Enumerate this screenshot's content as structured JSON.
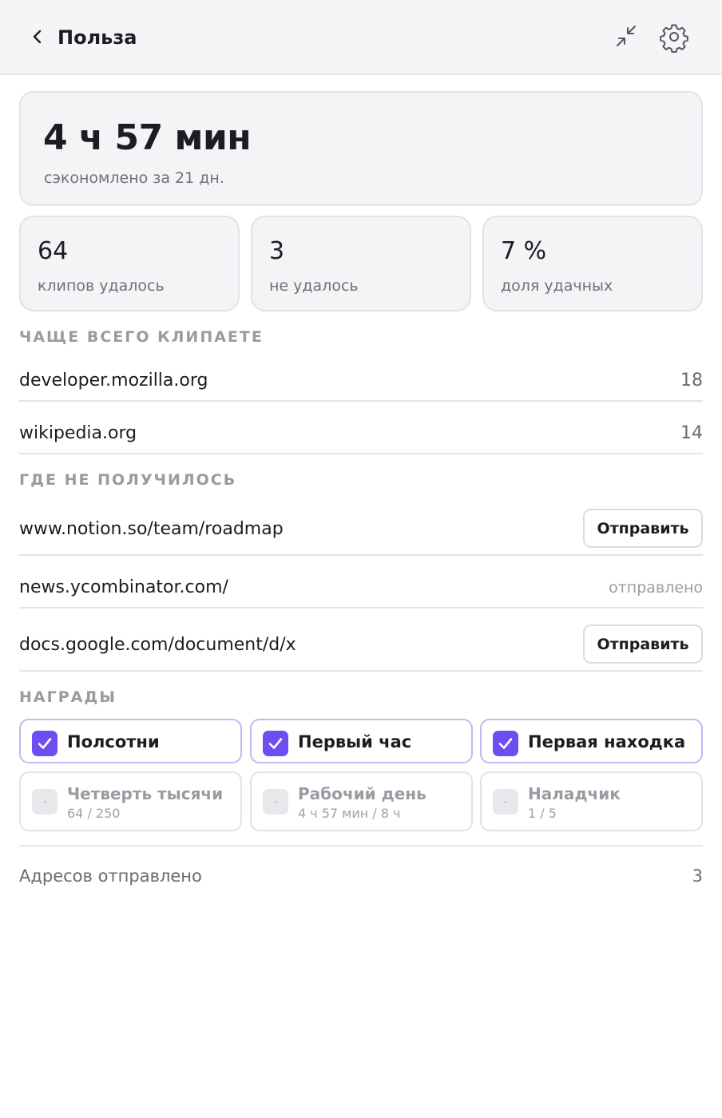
{
  "header": {
    "title": "Польза"
  },
  "summary": {
    "saved_time": "4 ч 57 мин",
    "saved_caption": "сэкономлено за 21 дн."
  },
  "stats": [
    {
      "value": "64",
      "label": "клипов удалось"
    },
    {
      "value": "3",
      "label": "не удалось"
    },
    {
      "value": "7 %",
      "label": "доля удачных"
    }
  ],
  "top_sites": {
    "heading": "ЧАЩЕ ВСЕГО КЛИПАЕТЕ",
    "items": [
      {
        "site": "developer.mozilla.org",
        "count": "18"
      },
      {
        "site": "wikipedia.org",
        "count": "14"
      }
    ]
  },
  "failures": {
    "heading": "ГДЕ НЕ ПОЛУЧИЛОСЬ",
    "items": [
      {
        "site": "www.notion.so/team/roadmap",
        "action": "Отправить"
      },
      {
        "site": "news.ycombinator.com/",
        "status": "отправлено"
      },
      {
        "site": "docs.google.com/document/d/x",
        "action": "Отправить"
      }
    ]
  },
  "awards": {
    "heading": "НАГРАДЫ",
    "items": [
      {
        "name": "Полсотни",
        "earned": true
      },
      {
        "name": "Первый час",
        "earned": true
      },
      {
        "name": "Первая находка",
        "earned": true
      },
      {
        "name": "Четверть тысячи",
        "earned": false,
        "progress": "64 / 250"
      },
      {
        "name": "Рабочий день",
        "earned": false,
        "progress": "4 ч 57 мин / 8 ч"
      },
      {
        "name": "Наладчик",
        "earned": false,
        "progress": "1 / 5"
      }
    ]
  },
  "footer": {
    "label": "Адресов отправлено",
    "value": "3"
  },
  "colors": {
    "accent": "#6e4ef0",
    "award_border": "#c3b8f2",
    "card_bg": "#f4f4f7",
    "header_bg": "#f5f5f7"
  },
  "icons": {
    "back": "chevron-left-icon",
    "collapse": "collapse-arrows-icon",
    "settings": "gear-icon",
    "check": "check-icon"
  }
}
